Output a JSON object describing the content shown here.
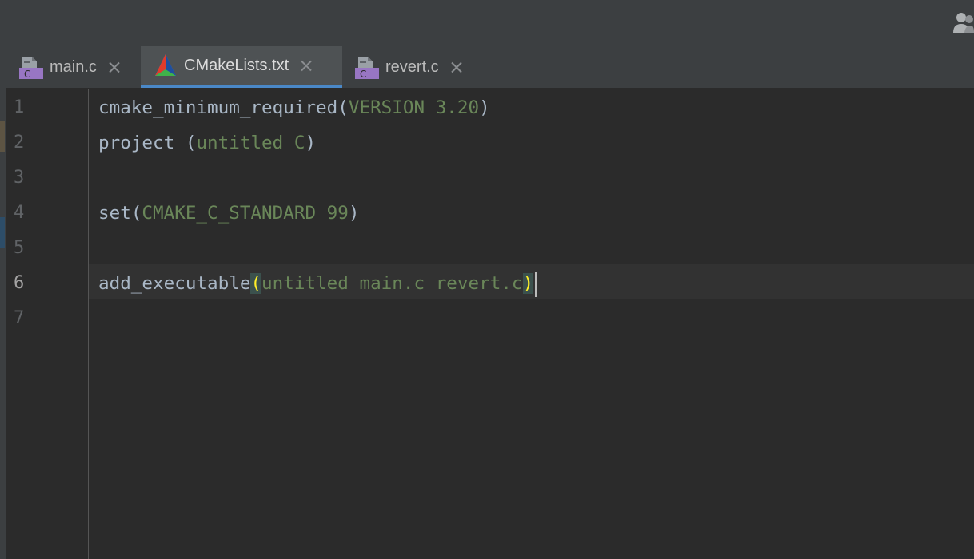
{
  "tabs": [
    {
      "label": "main.c",
      "icon": "c-file-icon",
      "active": false
    },
    {
      "label": "CMakeLists.txt",
      "icon": "cmake-icon",
      "active": true
    },
    {
      "label": "revert.c",
      "icon": "c-file-icon",
      "active": false
    }
  ],
  "file_icon_letter": "C",
  "editor": {
    "line_numbers": [
      "1",
      "2",
      "3",
      "4",
      "5",
      "6",
      "7"
    ],
    "current_line": "6",
    "lines": [
      {
        "fn": "cmake_minimum_required",
        "open": "(",
        "args": "VERSION 3.20",
        "close": ")"
      },
      {
        "fn": "project ",
        "open": "(",
        "args": "untitled C",
        "close": ")"
      },
      {
        "fn": "",
        "open": "",
        "args": "",
        "close": ""
      },
      {
        "fn": "set",
        "open": "(",
        "args": "CMAKE_C_STANDARD 99",
        "close": ")"
      },
      {
        "fn": "",
        "open": "",
        "args": "",
        "close": ""
      },
      {
        "fn": "add_executable",
        "open": "(",
        "args": "untitled main.c revert.c",
        "close": ")"
      },
      {
        "fn": "",
        "open": "",
        "args": "",
        "close": ""
      }
    ]
  },
  "colors": {
    "background": "#2b2b2b",
    "tab_active_underline": "#4a88c7",
    "string_arg": "#6a8759",
    "bracket_match": "#ffef28"
  }
}
